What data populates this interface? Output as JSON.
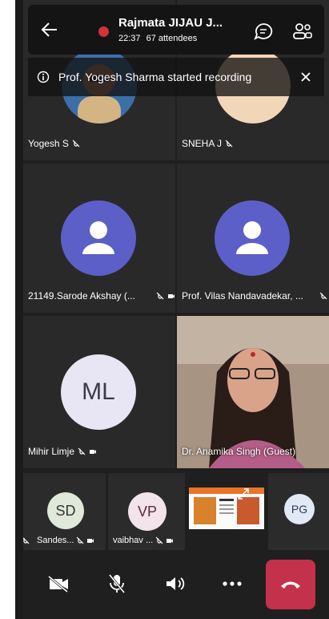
{
  "meeting": {
    "title": "Rajmata JIJAU J...",
    "duration": "22:37",
    "attendees": "67 attendees"
  },
  "banner": {
    "text": "Prof. Yogesh Sharma started recording"
  },
  "tiles": {
    "t1": {
      "name": "Yogesh S"
    },
    "t2": {
      "name": "SNEHA J"
    },
    "t3": {
      "name": "21149.Sarode Akshay (..."
    },
    "t4": {
      "name": "Prof. Vilas Nandavadekar, ..."
    },
    "t5": {
      "name": "Mihir Limje",
      "initials": "ML"
    },
    "t6": {
      "name": "Dr. Anamika Singh (Guest)"
    }
  },
  "strip": {
    "s1": {
      "initials": "SD",
      "name": "Sandes..."
    },
    "s2": {
      "initials": "VP",
      "name": "vaibhav ..."
    },
    "s3": {
      "initials": "PG"
    }
  },
  "colors": {
    "avatar_purple": "#5b5fc7",
    "avatar_lavender": "#e8e6f5",
    "hangup_red": "#c4314b",
    "recording_red": "#d13438"
  }
}
